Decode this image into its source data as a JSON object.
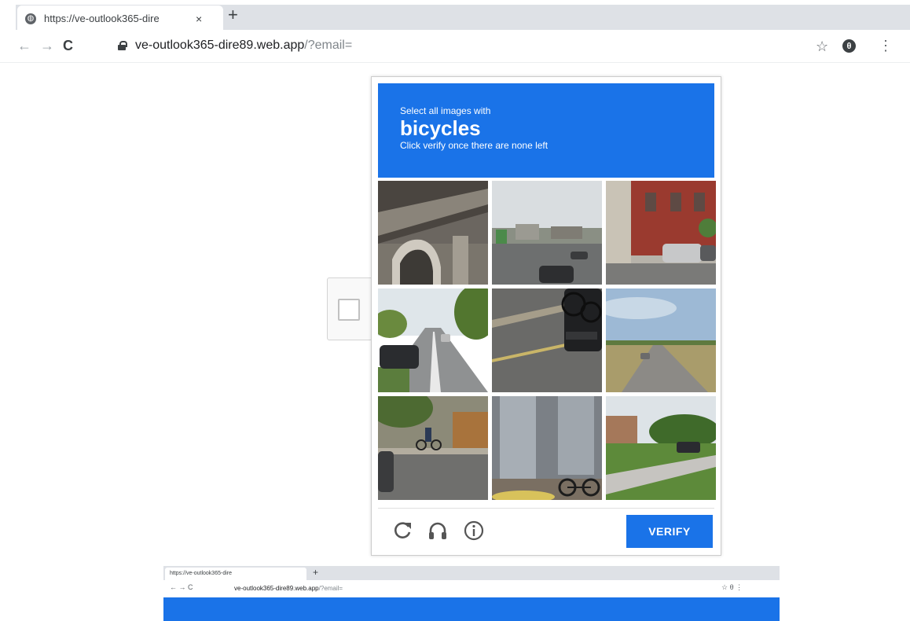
{
  "browser": {
    "tab_title": "https://ve-outlook365-dire",
    "tab_close": "×",
    "new_tab": "+",
    "favicon": "globe-icon",
    "url_host": "ve-outlook365-dire89.web.app",
    "url_path": "/?email=",
    "nav": {
      "back": "←",
      "forward": "→",
      "reload": "C"
    },
    "star": "☆",
    "profile": "θ",
    "menu": "⋮"
  },
  "captcha": {
    "prompt_small": "Select all images with",
    "prompt_target": "bicycles",
    "prompt_hint": "Click verify once there are none left",
    "verify_label": "VERIFY",
    "accent_color": "#1a73e8",
    "tiles": [
      "overpass arch",
      "street with cars",
      "brick building street",
      "suburban road",
      "car with bike rack",
      "open road",
      "cyclist on street",
      "pillar with bicycle",
      "park street"
    ],
    "footer_icons": [
      "reload-icon",
      "headphones-icon",
      "info-icon"
    ]
  },
  "mini_screenshot": {
    "tab_title": "https://ve-outlook365-dire",
    "new_tab": "+",
    "url_host": "ve-outlook365-dire89.web.app",
    "url_path": "/?email=",
    "nav": "← → C",
    "right_icons": "☆ θ ⋮"
  }
}
